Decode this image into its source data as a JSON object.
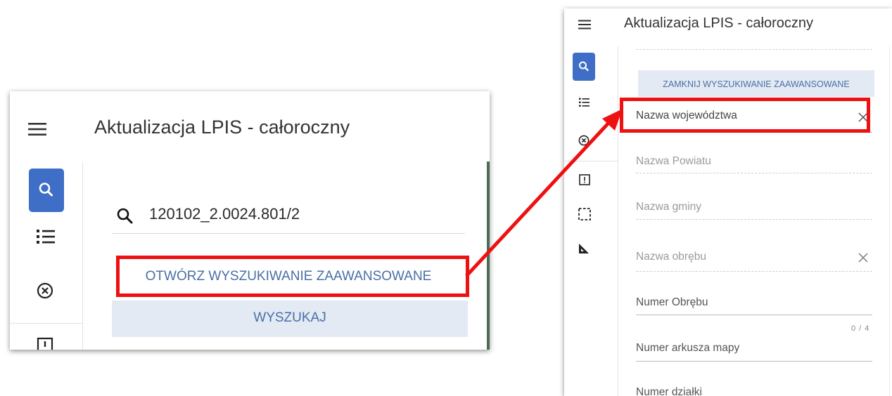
{
  "left_panel": {
    "title": "Aktualizacja LPIS - całoroczny",
    "search_value": "120102_2.0024.801/2",
    "open_advanced_label": "OTWÓRZ WYSZUKIWANIE ZAAWANSOWANE",
    "search_button_label": "WYSZUKAJ"
  },
  "right_panel": {
    "title": "Aktualizacja LPIS - całoroczny",
    "close_advanced_label": "ZAMKNIJ WYSZUKIWANIE ZAAWANSOWANE",
    "fields": {
      "voivodeship": "Nazwa województwa",
      "county": "Nazwa Powiatu",
      "commune": "Nazwa gminy",
      "precinct_name": "Nazwa obrębu",
      "precinct_number": "Numer Obrębu",
      "precinct_counter": "0 / 4",
      "map_sheet": "Numer arkusza mapy",
      "parcel_number": "Numer działki"
    }
  },
  "icons": {
    "menu": "menu-icon",
    "search": "search-icon",
    "list": "list-icon",
    "clear": "clear-circle-icon",
    "alert": "alert-square-icon",
    "select_area": "select-area-icon",
    "measure": "ruler-triangle-icon",
    "close": "close-icon"
  },
  "colors": {
    "accent": "#3e6ec5",
    "button_text": "#4a6fa5",
    "button_bg": "#e3eaf4",
    "highlight": "#ee1111"
  }
}
